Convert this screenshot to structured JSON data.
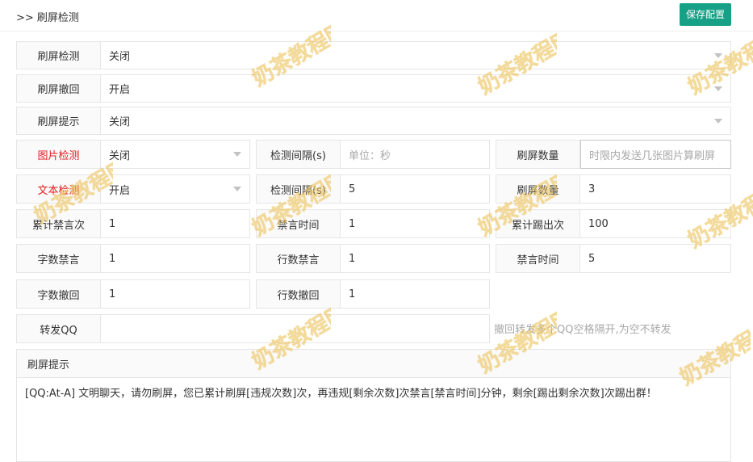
{
  "page_title": ">> 刷屏检测",
  "save_label": "保存配置",
  "rows": {
    "detect": {
      "label": "刷屏检测",
      "value": "关闭"
    },
    "recall": {
      "label": "刷屏撤回",
      "value": "开启"
    },
    "prompt": {
      "label": "刷屏提示",
      "value": "关闭"
    },
    "image_detect": {
      "label": "图片检测",
      "value": "关闭"
    },
    "image_interval": {
      "label": "检测间隔(s)",
      "placeholder": "单位：秒"
    },
    "image_count": {
      "label": "刷屏数量",
      "placeholder": "时限内发送几张图片算刷屏"
    },
    "text_detect": {
      "label": "文本检测",
      "value": "开启"
    },
    "text_interval": {
      "label": "检测间隔(s)",
      "value": "5"
    },
    "text_count": {
      "label": "刷屏数量",
      "value": "3"
    },
    "mute_accum": {
      "label": "累计禁言次",
      "value": "1"
    },
    "mute_time": {
      "label": "禁言时间",
      "value": "1"
    },
    "kick_accum": {
      "label": "累计踢出次",
      "value": "100"
    },
    "char_mute": {
      "label": "字数禁言",
      "value": "1"
    },
    "line_mute": {
      "label": "行数禁言",
      "value": "1"
    },
    "mute_time2": {
      "label": "禁言时间",
      "value": "5"
    },
    "char_recall": {
      "label": "字数撤回",
      "value": "1"
    },
    "line_recall": {
      "label": "行数撤回",
      "value": "1"
    },
    "forward_qq": {
      "label": "转发QQ",
      "value": ""
    }
  },
  "forward_hint": "撤回转发多个QQ空格隔开,为空不转发",
  "prompt_text": {
    "title": "刷屏提示",
    "content": "[QQ:At-A] 文明聊天，请勿刷屏，您已累计刷屏[违规次数]次，再违规[剩余次数]次禁言[禁言时间]分钟，剩余[踢出剩余次数]次踢出群！"
  },
  "watermark": "奶茶教程网",
  "colors": {
    "accent": "#16a085",
    "required_label": "#e02020",
    "placeholder": "#a8a8a8"
  }
}
